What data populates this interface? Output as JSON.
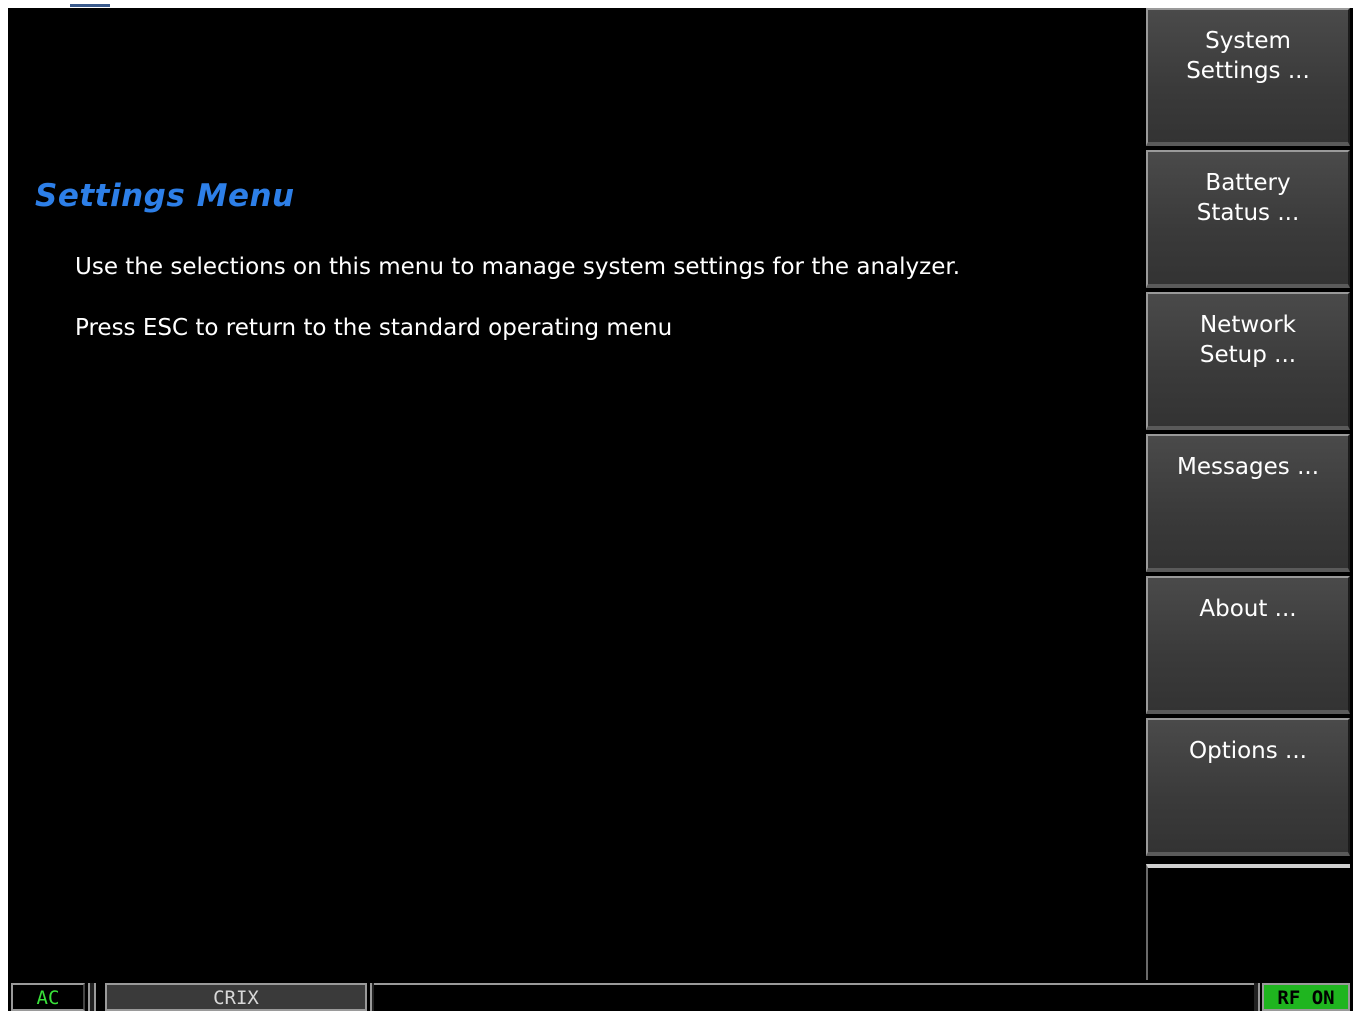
{
  "main": {
    "title": "Settings Menu",
    "lines": [
      "Use the selections on this menu to manage system settings for the analyzer.",
      "Press ESC to return to the standard operating menu"
    ]
  },
  "softkeys": [
    {
      "line1": "System",
      "line2": "Settings ..."
    },
    {
      "line1": "Battery",
      "line2": "Status ..."
    },
    {
      "line1": "Network",
      "line2": "Setup ..."
    },
    {
      "line1": "Messages ...",
      "line2": ""
    },
    {
      "line1": "About ...",
      "line2": ""
    },
    {
      "line1": "Options ...",
      "line2": ""
    }
  ],
  "statusbar": {
    "power": "AC",
    "mode": "CRIX",
    "rf": "RF ON"
  },
  "colors": {
    "title": "#2d7fe8",
    "power": "#39e13a",
    "rf_background": "#1fb51f"
  }
}
